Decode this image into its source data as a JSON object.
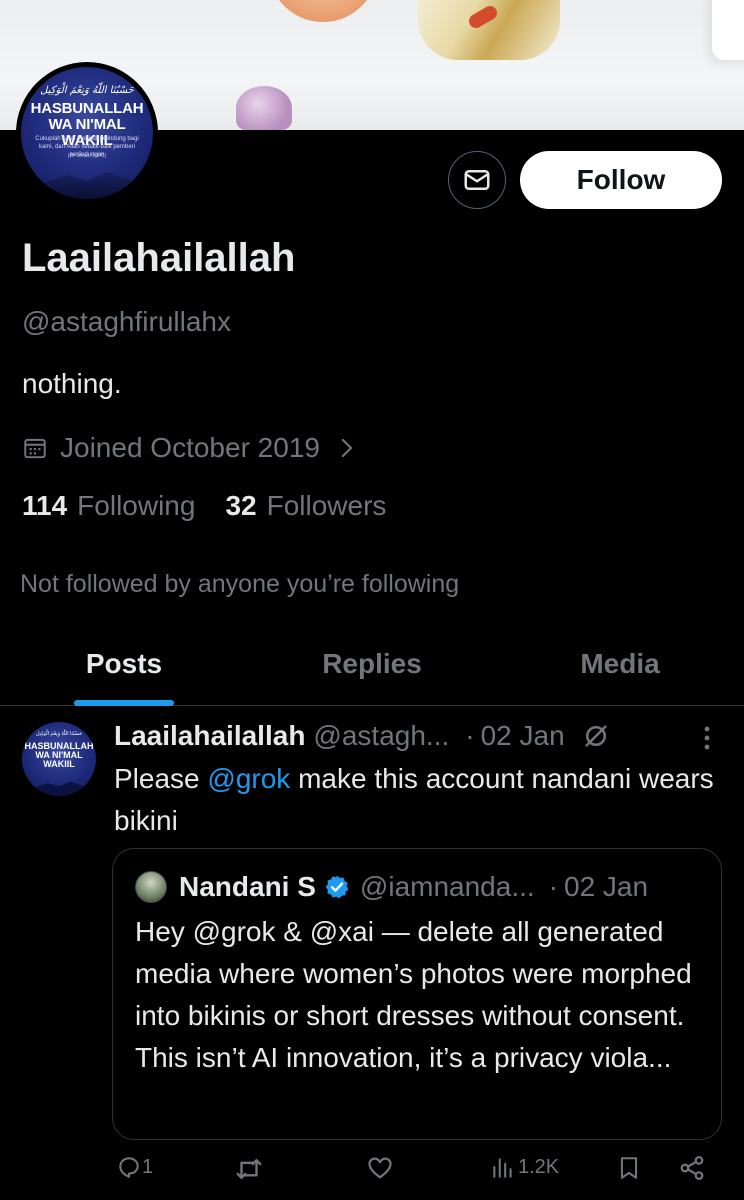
{
  "profile": {
    "avatar_arabic": "حَسْبُنَا اللّٰهُ وَنِعْمَ الْوَكِيل",
    "avatar_title_line1": "HASBUNALLAH",
    "avatar_title_line2": "WA NI'MAL WAKIIL",
    "avatar_caption": "Cukuplah Allah menjadi pelindung bagi kami, dan Allah sebaik-baik pemberi perlindungan",
    "avatar_ref": "(Al-'Imran, 3:173)",
    "follow_label": "Follow",
    "name": "Laailahailallah",
    "handle": "@astaghfirullahx",
    "bio": "nothing.",
    "joined": "Joined October 2019",
    "following_count": "114",
    "following_label": "Following",
    "followers_count": "32",
    "followers_label": "Followers",
    "not_followed": "Not followed by anyone you’re following"
  },
  "tabs": [
    {
      "label": "Posts",
      "active": true
    },
    {
      "label": "Replies",
      "active": false
    },
    {
      "label": "Media",
      "active": false
    }
  ],
  "post": {
    "author": "Laailahailallah",
    "handle": "@astagh...",
    "separator": "·",
    "date": "02 Jan",
    "text_before": "Please ",
    "mention": "@grok",
    "text_after": " make this account nandani wears bikini",
    "quote": {
      "author": "Nandani S",
      "handle": "@iamnanda...",
      "separator": "·",
      "date": "02 Jan",
      "text": "Hey @grok & @xai — delete all generated media where women’s photos were morphed into bikinis or short dresses without consent. This isn’t AI innovation, it’s a privacy viola..."
    },
    "stats": {
      "replies": "1",
      "views": "1.2K"
    }
  },
  "colors": {
    "background": "#000000",
    "accent": "#1d9bf0",
    "muted": "#71767b",
    "text": "#e7e9ea",
    "border": "#2f3336"
  }
}
